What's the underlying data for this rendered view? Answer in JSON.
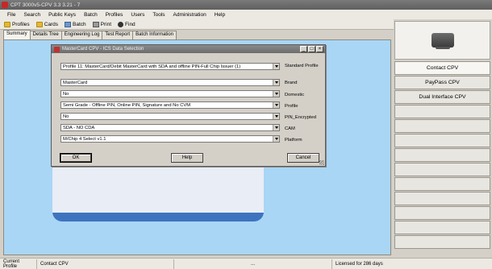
{
  "window": {
    "title": "CPT 3000v5-CPV 3.3   3.21 - 7"
  },
  "menu": [
    "File",
    "Search",
    "Public Keys",
    "Batch",
    "Profiles",
    "Users",
    "Tools",
    "Administration",
    "Help"
  ],
  "toolbar": {
    "profiles": "Profiles",
    "cards": "Cards",
    "batch": "Batch",
    "print": "Print",
    "find": "Find"
  },
  "tabs": [
    "Summary",
    "Details Tree",
    "Engineering Log",
    "Test Report",
    "Batch Information"
  ],
  "dialog": {
    "title": "MasterCard CPV - ICS Data Selection",
    "fields": [
      {
        "value": "Profile 11: MasterCard/Debit MasterCard with SDA and offline PIN-Full Chip Issuer (1)",
        "label": "Standard Profile"
      },
      {
        "value": "MasterCard",
        "label": "Brand"
      },
      {
        "value": "No",
        "label": "Domestic"
      },
      {
        "value": "Semi Grade - Offline PIN, Online PIN, Signature and No CVM",
        "label": "Profile"
      },
      {
        "value": "No",
        "label": "PIN_Encrypted"
      },
      {
        "value": "SDA - NO CDA",
        "label": "CAM"
      },
      {
        "value": "M/Chip 4 Select v1.1",
        "label": "Platform"
      }
    ],
    "ok": "OK",
    "help": "Help",
    "cancel": "Cancel"
  },
  "sidebar": {
    "buttons": [
      "Contact CPV",
      "PayPass CPV",
      "Dual Interface CPV"
    ]
  },
  "status": {
    "label": "Current Profile",
    "profile": "Contact CPV",
    "mid": "...",
    "license": "Licensed for 286 days"
  }
}
